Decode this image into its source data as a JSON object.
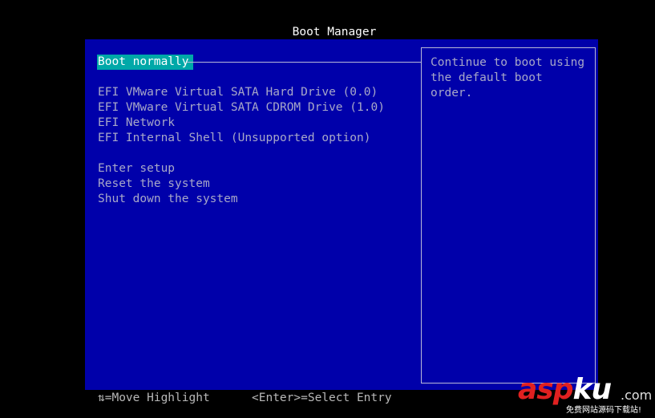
{
  "title": "Boot Manager",
  "menu": {
    "selected": "Boot normally",
    "devices": [
      "EFI VMware Virtual SATA Hard Drive (0.0)",
      "EFI VMware Virtual SATA CDROM Drive (1.0)",
      "EFI Network",
      "EFI Internal Shell (Unsupported option)"
    ],
    "actions": [
      "Enter setup",
      "Reset the system",
      "Shut down the system"
    ]
  },
  "help": {
    "text": "Continue to boot using\nthe default boot order."
  },
  "footer": {
    "move": "⇅=Move Highlight",
    "select": "<Enter>=Select Entry"
  },
  "watermark": {
    "brand_main": "asp",
    "brand_accent": "ku",
    "domain": ".com",
    "tagline": "免费网站源码下载站!"
  },
  "colors": {
    "panel_bg": "#0000aa",
    "highlight_bg": "#00a8a8",
    "text": "#a8a8c8"
  }
}
